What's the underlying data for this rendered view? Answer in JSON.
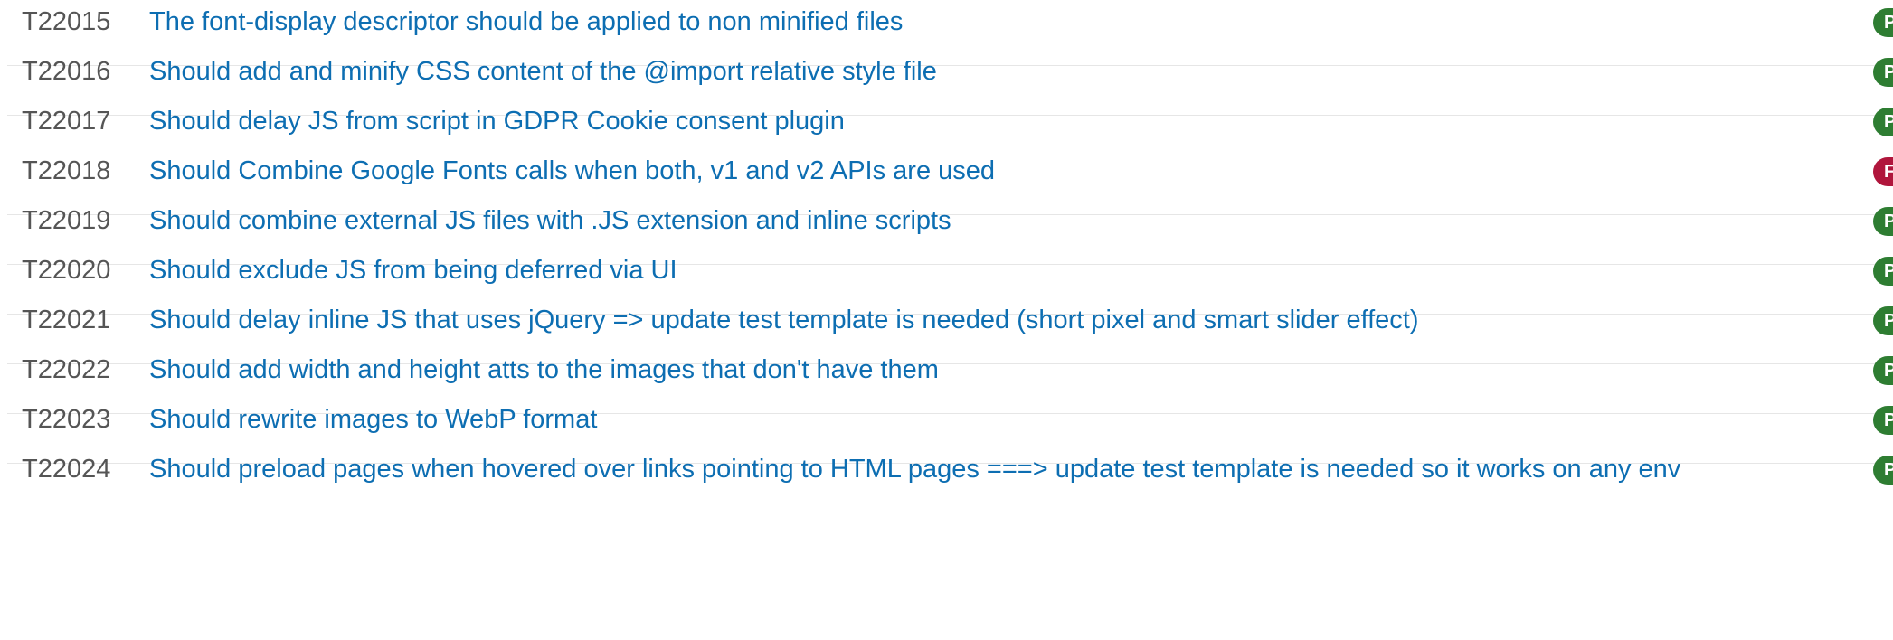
{
  "colors": {
    "pass": "#2e7d32",
    "fail": "#b0163c",
    "link": "#0d6eb2",
    "id_text": "#555555",
    "divider": "#e6e6e6"
  },
  "tests": [
    {
      "id": "T22015",
      "title": "The font-display descriptor should be applied to non minified files",
      "status": "pass",
      "badge_text": "P"
    },
    {
      "id": "T22016",
      "title": "Should add and minify CSS content of the @import relative style file",
      "status": "pass",
      "badge_text": "P"
    },
    {
      "id": "T22017",
      "title": "Should delay JS from script in GDPR Cookie consent plugin",
      "status": "pass",
      "badge_text": "P"
    },
    {
      "id": "T22018",
      "title": "Should Combine Google Fonts calls when both, v1 and v2 APIs are used",
      "status": "fail",
      "badge_text": "F"
    },
    {
      "id": "T22019",
      "title": "Should combine external JS files with .JS extension and inline scripts",
      "status": "pass",
      "badge_text": "P"
    },
    {
      "id": "T22020",
      "title": "Should exclude JS from being deferred via UI",
      "status": "pass",
      "badge_text": "P"
    },
    {
      "id": "T22021",
      "title": "Should delay inline JS that uses jQuery => update test template is needed (short pixel and smart slider effect)",
      "status": "pass",
      "badge_text": "P"
    },
    {
      "id": "T22022",
      "title": "Should add width and height atts to the images that don't have them",
      "status": "pass",
      "badge_text": "P"
    },
    {
      "id": "T22023",
      "title": "Should rewrite images to WebP format",
      "status": "pass",
      "badge_text": "P"
    },
    {
      "id": "T22024",
      "title": "Should preload pages when hovered over links pointing to HTML pages ===> update test template is needed so it works on any env",
      "status": "pass",
      "badge_text": "P"
    }
  ]
}
